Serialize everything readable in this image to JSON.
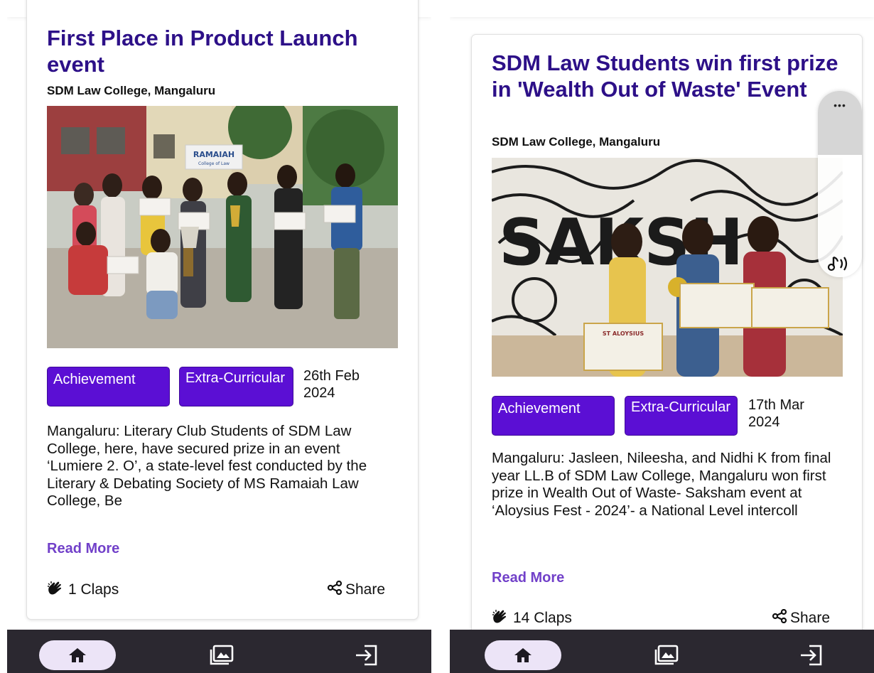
{
  "left_card": {
    "title": "First Place in Product Launch event",
    "college": "SDM Law College, Mangaluru",
    "photo_sign": "RAMAIAH",
    "photo_sign_sub": "College of Law",
    "tag1": "Achievement",
    "tag2": "Extra-Curricular",
    "date": "26th Feb 2024",
    "body": "Mangaluru: Literary Club Students of SDM Law College, here, have secured prize in an event ‘Lumiere 2. O’, a state-level fest conducted by the Literary & Debating Society of MS Ramaiah Law College, Be",
    "read_more": "Read More",
    "claps": "1 Claps",
    "share": "Share"
  },
  "right_card": {
    "title": "SDM Law Students win first prize in 'Wealth Out of Waste' Event",
    "college": "SDM Law College, Mangaluru",
    "certificate_label": "ST ALOYSIUS",
    "tag1": "Achievement",
    "tag2": "Extra-Curricular",
    "date": "17th Mar 2024",
    "body": "Mangaluru: Jasleen, Nileesha, and Nidhi K from final year LL.B of SDM Law College, Mangaluru won first prize in Wealth Out of Waste- Saksham event at ‘Aloysius Fest - 2024’- a National Level intercoll",
    "read_more": "Read More",
    "claps": "14 Claps",
    "share": "Share"
  },
  "overlay": {
    "menu_dots": "•••"
  },
  "nav": {
    "home_icon": "home-icon",
    "gallery_icon": "gallery-icon",
    "login_icon": "login-icon"
  },
  "colors": {
    "title": "#2d1088",
    "tag_bg": "#5b0fd4",
    "read_more": "#7140c9",
    "navbar": "#2b2830",
    "nav_active_pill": "#ece4f7"
  }
}
